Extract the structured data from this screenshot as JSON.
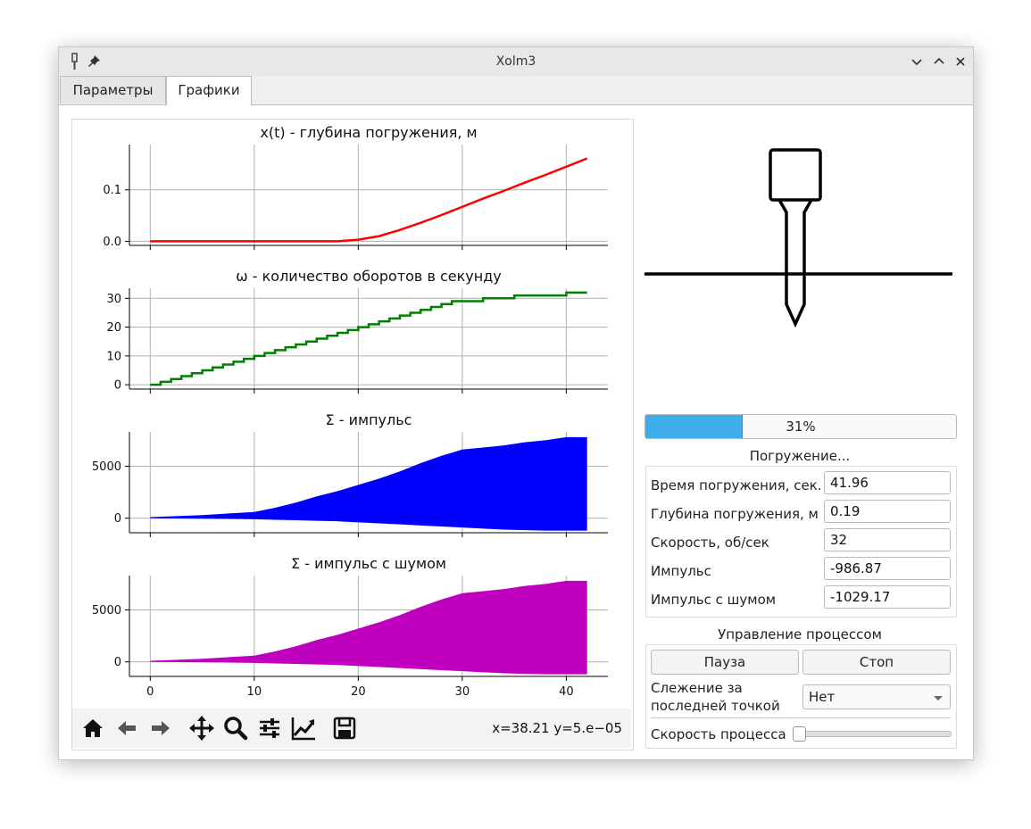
{
  "window": {
    "title": "Xolm3"
  },
  "tabs": [
    {
      "label": "Параметры",
      "active": false
    },
    {
      "label": "Графики",
      "active": true
    }
  ],
  "charts": [
    {
      "id": "x",
      "title": "x(t) - глубина погружения, м",
      "color": "#ff0000",
      "yticks": [
        "0.0",
        "0.1"
      ],
      "type": "line"
    },
    {
      "id": "omega",
      "title": "ω - количество оборотов в секунду",
      "color": "#008000",
      "yticks": [
        "0",
        "10",
        "20",
        "30"
      ],
      "type": "line-step"
    },
    {
      "id": "imp",
      "title": "Σ - импульс",
      "color": "#0000ff",
      "yticks": [
        "0",
        "5000"
      ],
      "type": "area"
    },
    {
      "id": "impnoise",
      "title": "Σ - импульс с шумом",
      "color": "#bf00bf",
      "yticks": [
        "0",
        "5000"
      ],
      "type": "area"
    }
  ],
  "chart_data": [
    {
      "type": "line",
      "title": "x(t) - глубина погружения, м",
      "x": [
        0,
        5,
        10,
        15,
        18,
        20,
        22,
        24,
        26,
        28,
        30,
        32,
        34,
        36,
        38,
        40,
        42
      ],
      "y": [
        0,
        0,
        0,
        0,
        0,
        0.003,
        0.01,
        0.022,
        0.036,
        0.051,
        0.067,
        0.083,
        0.098,
        0.114,
        0.129,
        0.145,
        0.161
      ],
      "xlim": [
        -2,
        44
      ],
      "ylim": [
        -0.008,
        0.188
      ],
      "grid": true
    },
    {
      "type": "line",
      "title": "ω - количество оборотов в секунду",
      "x": [
        0,
        1,
        2,
        3,
        4,
        5,
        6,
        7,
        8,
        9,
        10,
        11,
        12,
        13,
        14,
        15,
        16,
        17,
        18,
        19,
        20,
        21,
        22,
        23,
        24,
        25,
        26,
        27,
        28,
        29,
        30,
        31,
        32,
        33,
        34,
        35,
        36,
        37,
        38,
        39,
        40,
        41,
        42
      ],
      "y": [
        0,
        1,
        2,
        3,
        4,
        5,
        6,
        7,
        8,
        9,
        10,
        11,
        12,
        13,
        14,
        15,
        16,
        17,
        18,
        19,
        20,
        21,
        22,
        23,
        24,
        25,
        26,
        27,
        28,
        29,
        29,
        29,
        30,
        30,
        30,
        31,
        31,
        31,
        31,
        31,
        32,
        32,
        32
      ],
      "xlim": [
        -2,
        44
      ],
      "ylim": [
        -1.5,
        33.5
      ],
      "grid": true
    },
    {
      "type": "area",
      "title": "Σ - импульс",
      "x": [
        0,
        5,
        10,
        12,
        14,
        16,
        18,
        20,
        22,
        24,
        26,
        28,
        30,
        32,
        34,
        36,
        38,
        40,
        42
      ],
      "upper": [
        100,
        300,
        600,
        1000,
        1500,
        2100,
        2600,
        3200,
        3800,
        4500,
        5300,
        6000,
        6600,
        6800,
        7000,
        7300,
        7500,
        7800,
        7800
      ],
      "lower": [
        0,
        -50,
        -100,
        -150,
        -200,
        -250,
        -300,
        -400,
        -500,
        -600,
        -700,
        -800,
        -900,
        -1000,
        -1100,
        -1150,
        -1200,
        -1200,
        -1200
      ],
      "xlim": [
        -2,
        44
      ],
      "ylim": [
        -1400,
        8300
      ],
      "grid": true
    },
    {
      "type": "area",
      "title": "Σ - импульс с шумом",
      "x": [
        0,
        5,
        10,
        12,
        14,
        16,
        18,
        20,
        22,
        24,
        26,
        28,
        30,
        32,
        34,
        36,
        38,
        40,
        42
      ],
      "upper": [
        100,
        300,
        600,
        1000,
        1500,
        2100,
        2600,
        3200,
        3800,
        4500,
        5300,
        6000,
        6600,
        6800,
        7000,
        7300,
        7500,
        7800,
        7800
      ],
      "lower": [
        0,
        -50,
        -100,
        -150,
        -200,
        -250,
        -300,
        -400,
        -500,
        -600,
        -700,
        -800,
        -900,
        -1000,
        -1100,
        -1150,
        -1200,
        -1200,
        -1200
      ],
      "xlim": [
        -2,
        44
      ],
      "ylim": [
        -1400,
        8300
      ],
      "grid": true
    }
  ],
  "xticks": [
    "0",
    "10",
    "20",
    "30",
    "40"
  ],
  "toolbar": {
    "icons": [
      "home-icon",
      "back-icon",
      "forward-icon",
      "pan-icon",
      "zoom-icon",
      "configure-icon",
      "edit-axes-icon",
      "save-icon"
    ],
    "coords": "x=38.21 y=5.e−05"
  },
  "progress": {
    "value": 0.31,
    "text": "31%"
  },
  "status": {
    "label": "Погружение..."
  },
  "fields": [
    {
      "label": "Время погружения, сек.",
      "value": "41.96"
    },
    {
      "label": "Глубина погружения, м",
      "value": "0.19"
    },
    {
      "label": "Скорость, об/сек",
      "value": "32"
    },
    {
      "label": "Импульс",
      "value": "-986.87"
    },
    {
      "label": "Импульс с шумом",
      "value": "-1029.17"
    }
  ],
  "control": {
    "title": "Управление процессом",
    "pause": "Пауза",
    "stop": "Стоп",
    "tracking_label_1": "Слежение за",
    "tracking_label_2": "последней точкой",
    "tracking_value": "Нет",
    "speed_label": "Скорость процесса",
    "speed_value": 0
  },
  "colors": {
    "accent": "#3daee9"
  }
}
